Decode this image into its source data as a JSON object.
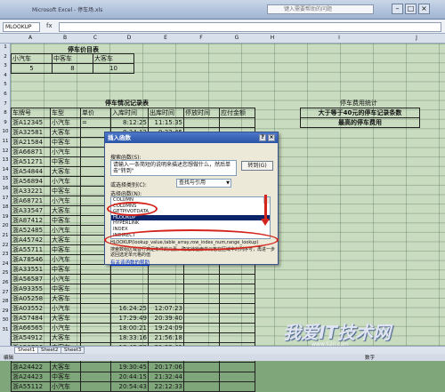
{
  "window": {
    "title": "Microsoft Excel - 停车场.xls",
    "help_placeholder": "键入需要帮助的问题"
  },
  "formula_bar": {
    "name_box": "MLOOKUP",
    "fx": "fx"
  },
  "columns": [
    "A",
    "B",
    "C",
    "D",
    "E",
    "F",
    "G",
    "H",
    "I",
    "J"
  ],
  "rows": [
    "1",
    "2",
    "3",
    "4",
    "5",
    "6",
    "7",
    "8",
    "9",
    "10",
    "11",
    "12",
    "13",
    "14",
    "15",
    "16",
    "17",
    "18",
    "19",
    "20",
    "21",
    "22",
    "23",
    "24",
    "25",
    "26",
    "27",
    "28",
    "29",
    "30",
    "31"
  ],
  "price_table": {
    "title": "停车价目表",
    "headers": [
      "小汽车",
      "中客车",
      "大客车"
    ],
    "values": [
      "5",
      "8",
      "10"
    ]
  },
  "record_table": {
    "title": "停车情况记录表",
    "headers": [
      "车牌号",
      "车型",
      "单价",
      "入库时间",
      "出库时间",
      "停放时间",
      "应付金额"
    ],
    "editing_cell": "=",
    "rows": [
      [
        "浙A12345",
        "小汽车",
        "8:12:25",
        "11:15:35"
      ],
      [
        "浙A32581",
        "大客车",
        "8:34:12",
        "9:32:45"
      ],
      [
        "浙A21584",
        "中客车",
        "",
        ""
      ],
      [
        "浙A66871",
        "小汽车",
        "",
        ""
      ],
      [
        "浙A51271",
        "中客车",
        "",
        ""
      ],
      [
        "浙A54844",
        "大客车",
        "",
        ""
      ],
      [
        "浙A56894",
        "小汽车",
        "",
        ""
      ],
      [
        "浙A33221",
        "中客车",
        "",
        ""
      ],
      [
        "浙A68721",
        "小汽车",
        "",
        ""
      ],
      [
        "浙A33547",
        "大客车",
        "",
        ""
      ],
      [
        "浙A87412",
        "中客车",
        "",
        ""
      ],
      [
        "浙A52485",
        "小汽车",
        "",
        ""
      ],
      [
        "浙A45742",
        "大客车",
        "",
        ""
      ],
      [
        "浙A55711",
        "中客车",
        "",
        ""
      ],
      [
        "浙A78546",
        "小汽车",
        "",
        ""
      ],
      [
        "浙A33551",
        "中客车",
        "",
        ""
      ],
      [
        "浙A56587",
        "小汽车",
        "",
        ""
      ],
      [
        "浙A93355",
        "中客车",
        "",
        ""
      ],
      [
        "浙A05258",
        "大客车",
        "",
        ""
      ],
      [
        "浙A03552",
        "小汽车",
        "16:24:25",
        "12:07:23"
      ],
      [
        "浙A57484",
        "大客车",
        "17:29:49",
        "20:39:40"
      ],
      [
        "浙A66565",
        "小汽车",
        "18:00:21",
        "19:24:09"
      ],
      [
        "浙A54912",
        "大客车",
        "18:33:16",
        "21:56:18"
      ],
      [
        "浙A56786",
        "中客车",
        "18:49:28",
        "21:33:41"
      ],
      [
        "浙A94658",
        "小汽车",
        "19:05:21",
        "19:45:23"
      ],
      [
        "浙A24422",
        "大客车",
        "19:30:45",
        "20:17:06"
      ],
      [
        "浙A24423",
        "中客车",
        "20:44:15",
        "21:32:44"
      ],
      [
        "浙A55112",
        "小汽车",
        "20:54:43",
        "22:12:33"
      ]
    ]
  },
  "stats_table": {
    "title": "停车费用统计",
    "rows": [
      "大于等于40元的停车记录条数",
      "最高的停车费用"
    ]
  },
  "dialog": {
    "title": "插入函数",
    "search_label": "搜索函数(S):",
    "search_text": "请输入一条简短的说明来描述您想做什么，然后单击\"转到\"",
    "go_button": "转到(G)",
    "category_label": "或选择类别(C):",
    "category_value": "查找与引用",
    "list_label": "选择函数(N):",
    "functions": [
      "COLUMN",
      "COLUMNS",
      "GETPIVOTDATA",
      "HLOOKUP",
      "HYPERLINK",
      "INDEX",
      "INDIRECT"
    ],
    "selected_index": 3,
    "syntax": "HLOOKUP(lookup_value,table_array,row_index_num,range_lookup)",
    "description": "搜索数组区域首行满足条件的元素，确定待检索单元格在区域中的列序号，再进一步返回选定单元格的值",
    "help_link": "有关该函数的帮助"
  },
  "sheet_tabs": [
    "Sheet1",
    "Sheet2",
    "Sheet3"
  ],
  "status": {
    "left": "编辑",
    "right": "数字"
  },
  "watermark": {
    "main": "我爱IT技术网",
    "sub": "www.52ij.com"
  },
  "colors": {
    "accent_red": "#d4241c",
    "grid_bg": "#c9dcc0",
    "dialog_title": "#2a55a8"
  }
}
